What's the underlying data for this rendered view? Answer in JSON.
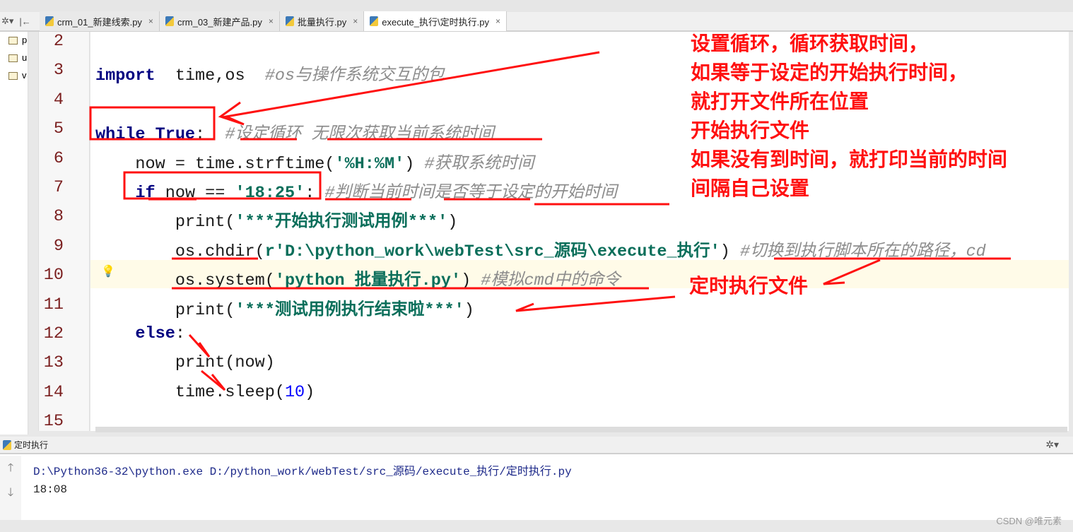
{
  "tabs": [
    {
      "label": "crm_01_新建线索.py",
      "active": false
    },
    {
      "label": "crm_03_新建产品.py",
      "active": false
    },
    {
      "label": "批量执行.py",
      "active": false
    },
    {
      "label": "execute_执行\\定时执行.py",
      "active": true
    }
  ],
  "close_glyph": "×",
  "project_items": [
    "p",
    "u",
    "v"
  ],
  "editor": {
    "lines": [
      {
        "num": "2",
        "tokens": []
      },
      {
        "num": "3",
        "tokens": [
          [
            "kw2",
            "import"
          ],
          [
            "",
            "  time,os  "
          ],
          [
            "cm",
            "#os与操作系统交互的包"
          ]
        ]
      },
      {
        "num": "4",
        "tokens": []
      },
      {
        "num": "5",
        "tokens": [
          [
            "kw",
            "while True"
          ],
          [
            "",
            ":  "
          ],
          [
            "cm",
            "#设定循环 无限次获取当前系统时间"
          ]
        ]
      },
      {
        "num": "6",
        "tokens": [
          [
            "",
            "    now = time.strftime("
          ],
          [
            "st",
            "'%H:%M'"
          ],
          [
            "",
            ") "
          ],
          [
            "cm",
            "#获取系统时间"
          ]
        ]
      },
      {
        "num": "7",
        "tokens": [
          [
            "",
            "    "
          ],
          [
            "kw",
            "if"
          ],
          [
            "",
            " now == "
          ],
          [
            "st",
            "'18:25'"
          ],
          [
            "",
            ": "
          ],
          [
            "cm",
            "#判断当前时间是否等于设定的开始时间"
          ]
        ]
      },
      {
        "num": "8",
        "tokens": [
          [
            "",
            "        print("
          ],
          [
            "st",
            "'***开始执行测试用例***'"
          ],
          [
            "",
            ")"
          ]
        ]
      },
      {
        "num": "9",
        "tokens": [
          [
            "",
            "        os.chdir("
          ],
          [
            "st",
            "r'D:\\python_work\\webTest\\src_源码\\execute_执行'"
          ],
          [
            "",
            ") "
          ],
          [
            "cm",
            "#切换到执行脚本所在的路径，cd"
          ]
        ]
      },
      {
        "num": "10",
        "tokens": [
          [
            "",
            "        os.system("
          ],
          [
            "st",
            "'python 批量执行.py'"
          ],
          [
            "",
            ") "
          ],
          [
            "cm",
            "#模拟cmd中的命令"
          ]
        ]
      },
      {
        "num": "11",
        "tokens": [
          [
            "",
            "        print("
          ],
          [
            "st",
            "'***测试用例执行结束啦***'"
          ],
          [
            "",
            ")"
          ]
        ]
      },
      {
        "num": "12",
        "tokens": [
          [
            "",
            "    "
          ],
          [
            "kw",
            "else"
          ],
          [
            "",
            ":"
          ]
        ]
      },
      {
        "num": "13",
        "tokens": [
          [
            "",
            "        print(now)"
          ]
        ]
      },
      {
        "num": "14",
        "tokens": [
          [
            "",
            "        time.sleep("
          ],
          [
            "nm",
            "10"
          ],
          [
            "",
            ")"
          ]
        ]
      },
      {
        "num": "15",
        "tokens": []
      }
    ]
  },
  "run_panel": {
    "title": "定时执行",
    "command": "D:\\Python36-32\\python.exe D:/python_work/webTest/src_源码/execute_执行/定时执行.py",
    "output": "18:08"
  },
  "annotations": {
    "main": [
      "设置循环，循环获取时间，",
      "如果等于设定的开始执行时间，",
      "就打开文件所在位置",
      "开始执行文件",
      "如果没有到时间，就打印当前的时间",
      "间隔自己设置"
    ],
    "timed": "定时执行文件",
    "color": "#ff1010"
  },
  "watermark": "CSDN @唯元素"
}
